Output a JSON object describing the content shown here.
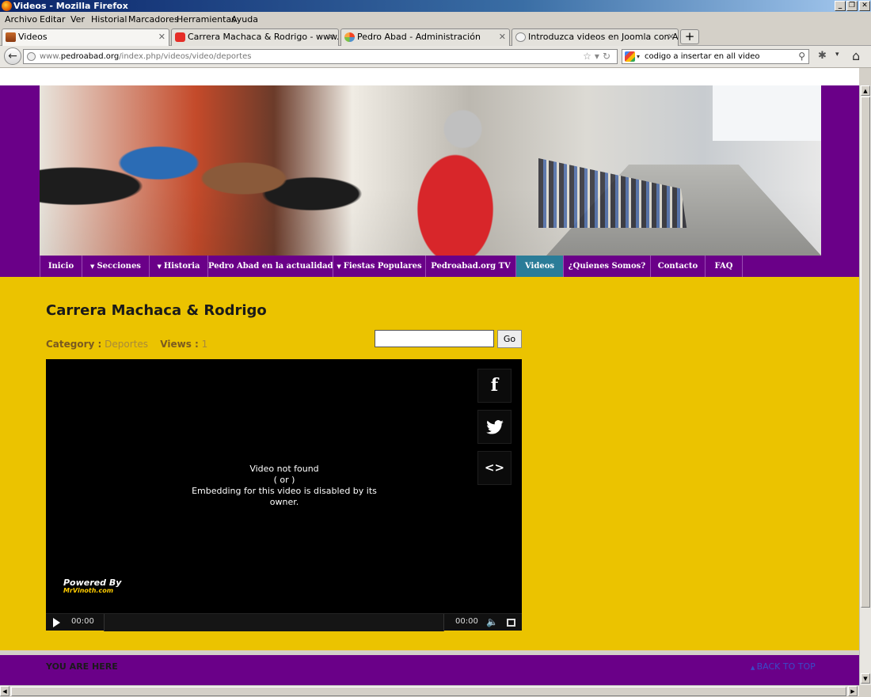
{
  "window": {
    "title": "Videos - Mozilla Firefox"
  },
  "menubar": [
    "Archivo",
    "Editar",
    "Ver",
    "Historial",
    "Marcadores",
    "Herramientas",
    "Ayuda"
  ],
  "tabs": [
    {
      "label": "Videos",
      "active": true
    },
    {
      "label": "Carrera Machaca & Rodrigo - www.pedro...",
      "active": false
    },
    {
      "label": "Pedro Abad - Administración",
      "active": false
    },
    {
      "label": "Introduzca videos en Joomla con All-vide...",
      "active": false
    }
  ],
  "address": {
    "domain_prefix": "www.",
    "domain": "pedroabad.org",
    "path": "/index.php/videos/video/deportes"
  },
  "search": {
    "value": "codigo a insertar en all video"
  },
  "site_menu": [
    {
      "label": "Inicio",
      "caret": false,
      "active": false
    },
    {
      "label": "Secciones",
      "caret": true,
      "active": false
    },
    {
      "label": "Historia",
      "caret": true,
      "active": false
    },
    {
      "label": "Pedro Abad en la actualidad",
      "caret": false,
      "active": false
    },
    {
      "label": "Fiestas Populares",
      "caret": true,
      "active": false
    },
    {
      "label": "Pedroabad.org TV",
      "caret": false,
      "active": false
    },
    {
      "label": "Videos",
      "caret": false,
      "active": true
    },
    {
      "label": "¿Quienes Somos?",
      "caret": false,
      "active": false
    },
    {
      "label": "Contacto",
      "caret": false,
      "active": false
    },
    {
      "label": "FAQ",
      "caret": false,
      "active": false
    }
  ],
  "content": {
    "title": "Carrera Machaca & Rodrigo",
    "category_label": "Category :",
    "category_value": "Deportes",
    "views_label": "Views :",
    "views_value": "1",
    "search_value": "",
    "go_label": "Go"
  },
  "player": {
    "msg_line1": "Video not found",
    "msg_line2": "( or )",
    "msg_line3": "Embedding for this video is disabled by its owner.",
    "powered_by": "Powered By",
    "brand": "MrVinoth.com",
    "time_current": "00:00",
    "time_total": "00:00",
    "social": {
      "facebook": "f",
      "embed": "<>"
    }
  },
  "footer": {
    "you_are_here": "YOU ARE HERE",
    "back_to_top": "BACK TO TOP"
  },
  "colors": {
    "purple": "#6a0088",
    "gold": "#ebc300",
    "active_menu": "#2a7c98"
  }
}
